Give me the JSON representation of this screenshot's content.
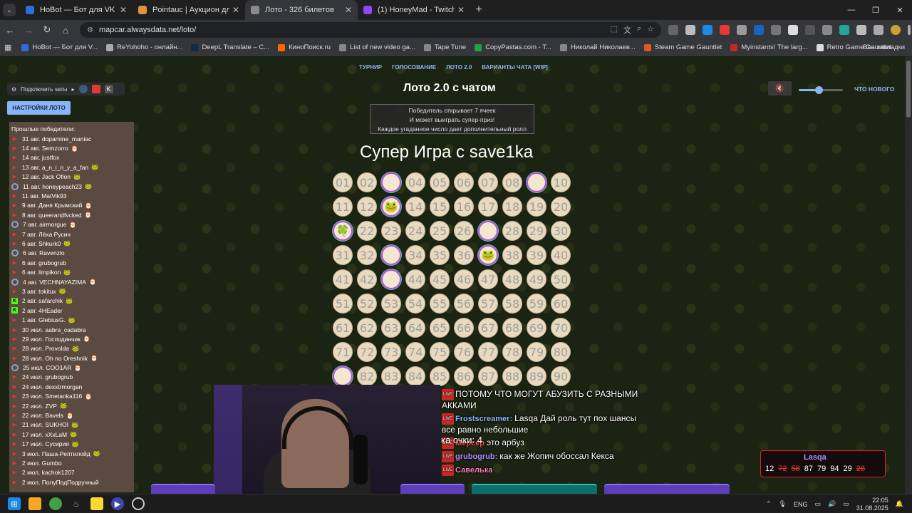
{
  "browser": {
    "tabs": [
      {
        "title": "HoBot — Бот для VK Video",
        "active": false,
        "color": "#2a6fdb"
      },
      {
        "title": "Pointauc | Аукцион для стримеров",
        "active": false,
        "color": "#e0913d"
      },
      {
        "title": "Лото - 326 билетов",
        "active": true,
        "color": "#8a8a8a"
      },
      {
        "title": "(1) HoneyMad - Twitch",
        "active": false,
        "color": "#9146ff"
      }
    ],
    "url": "mapcar.alwaysdata.net/loto/",
    "bookmarks": [
      {
        "label": "HoBot — Бот для V...",
        "color": "#2a6fdb"
      },
      {
        "label": "ReYohoho - онлайн...",
        "color": "#aaaaaa"
      },
      {
        "label": "DeepL Translate – C...",
        "color": "#0f2b46"
      },
      {
        "label": "КиноПоиск.ru",
        "color": "#ff6600"
      },
      {
        "label": "List of new video ga...",
        "color": "#888888"
      },
      {
        "label": "Tape Tune",
        "color": "#888888"
      },
      {
        "label": "CopyPastas.com - T...",
        "color": "#1fa34a"
      },
      {
        "label": "Николай Николаев...",
        "color": "#888888"
      },
      {
        "label": "Steam Game Gauntlet",
        "color": "#e25822"
      },
      {
        "label": "Myinstants! The larg...",
        "color": "#c62828"
      },
      {
        "label": "Retro Game Gauntlet",
        "color": "#dddddd"
      }
    ],
    "all_bookmarks": "Все закладки"
  },
  "page": {
    "nav": [
      "ТУРНИР",
      "ГОЛОСОВАНИЕ",
      "ЛОТО 2.0",
      "ВАРИАНТЫ ЧАТА [WIP]"
    ],
    "title": "Лото 2.0 с чатом",
    "info_lines": [
      "Победитель открывает 7 ячеек",
      "И может выиграть супер-приз!",
      "Каждое угаданное число дает дополнительный ролл"
    ],
    "subtitle": "Супер Игра с save1ka",
    "connect_chats": "Подключить чаты",
    "lotto_settings": "НАСТРОЙКИ ЛОТО",
    "whats_new": "ЧТО НОВОГО",
    "volume_level": 0.45,
    "winners_header": "Прошлые победители:",
    "winners": [
      {
        "text": "31 авг. dopamine_maniac",
        "src": "tw",
        "emote": ""
      },
      {
        "text": "14 авг. Semzorro",
        "src": "tw",
        "emote": "🎅"
      },
      {
        "text": "14 авг. justfox",
        "src": "tw",
        "emote": ""
      },
      {
        "text": "13 авг. a_n_i_n_y_a_fan",
        "src": "tw",
        "emote": "🐸"
      },
      {
        "text": "12 авг. Jack Ofion",
        "src": "tw",
        "emote": "🐸"
      },
      {
        "text": "11 авг. honeypeach23",
        "src": "gg",
        "emote": "🐸"
      },
      {
        "text": "11 авг. MatVik93",
        "src": "tw",
        "emote": ""
      },
      {
        "text": "9 авг. Даня Крымский",
        "src": "tw",
        "emote": "🎅"
      },
      {
        "text": "8 авг. queerandfvcked",
        "src": "tw",
        "emote": "🎅"
      },
      {
        "text": "7 авг. airmorgue",
        "src": "gg",
        "emote": "🎅"
      },
      {
        "text": "7 авг. Лёха Русич",
        "src": "tw",
        "emote": ""
      },
      {
        "text": "6 авг. Shkurk0",
        "src": "tw",
        "emote": "🐸"
      },
      {
        "text": "6 авг. Ravenzlo",
        "src": "gg",
        "emote": ""
      },
      {
        "text": "6 авг. grubogrub",
        "src": "tw",
        "emote": ""
      },
      {
        "text": "6 авг. limpikon",
        "src": "tw",
        "emote": "🐸"
      },
      {
        "text": "4 авг. VECHNAYAZIMA",
        "src": "gg",
        "emote": "🎅"
      },
      {
        "text": "3 авг. tokitux",
        "src": "tw",
        "emote": "🐸"
      },
      {
        "text": "2 авг. safarchik",
        "src": "kk",
        "emote": "🐸"
      },
      {
        "text": "2 авг. 4HEader",
        "src": "kk",
        "emote": ""
      },
      {
        "text": "1 авг. GlebiusG.",
        "src": "tw",
        "emote": "🐸"
      },
      {
        "text": "30 июл. aabra_cadabra",
        "src": "tw",
        "emote": ""
      },
      {
        "text": "29 июл. Господинчик",
        "src": "tw",
        "emote": "🎅"
      },
      {
        "text": "28 июл. Provolda",
        "src": "tw",
        "emote": "🐸"
      },
      {
        "text": "28 июл. Oh no Oreshnik",
        "src": "tw",
        "emote": "🎅"
      },
      {
        "text": "25 июл. COO1AR",
        "src": "gg",
        "emote": "🎅"
      },
      {
        "text": "24 июл. grubogrub",
        "src": "tw",
        "emote": ""
      },
      {
        "text": "24 июл. dexxtrmorgan",
        "src": "tw",
        "emote": ""
      },
      {
        "text": "23 июл. Smetanka116",
        "src": "tw",
        "emote": "🎅"
      },
      {
        "text": "22 июл. ZVP",
        "src": "tw",
        "emote": "🐸"
      },
      {
        "text": "22 июл. Bavels",
        "src": "tw",
        "emote": "🎅"
      },
      {
        "text": "21 июл. SUKHOI",
        "src": "tw",
        "emote": "🐸"
      },
      {
        "text": "17 июл. xXxLaM",
        "src": "tw",
        "emote": "🐸"
      },
      {
        "text": "17 июл. Сусирия",
        "src": "tw",
        "emote": "🐸"
      },
      {
        "text": "3 июл. Паша-Рептилойд",
        "src": "tw",
        "emote": "🐸"
      },
      {
        "text": "2 июл. Gumbo",
        "src": "tw",
        "emote": ""
      },
      {
        "text": "2 июл. kachok1207",
        "src": "tw",
        "emote": ""
      },
      {
        "text": "2 июл. ПолуПодПодручный",
        "src": "tw",
        "emote": ""
      }
    ],
    "marked_cells": {
      "03": "",
      "09": "",
      "13": "🐸",
      "21": "🍀",
      "27": "",
      "33": "",
      "37": "🐸",
      "43": "",
      "81": ""
    }
  },
  "chat": {
    "messages": [
      {
        "nick": "",
        "text": "ПОТОМУ ЧТО МОГУТ АБУЗИТЬ С РАЗНЫМИ АККАМИ",
        "nick_class": ""
      },
      {
        "nick": "Frostscreamer:",
        "text": "Lasqa Дай роль тут пох шансы все равно небольшие",
        "nick_class": "nick-blue"
      },
      {
        "nick": "Мерсер",
        "text": "это арбуз",
        "nick_class": "nick-red"
      },
      {
        "nick": "grubogrub:",
        "text": "как же Жопич обоссал Кекса",
        "nick_class": "nick-purple"
      }
    ],
    "points_text": "ка очки: 4",
    "last_nick": "Савелька"
  },
  "ticket": {
    "user": "Lasqa",
    "numbers": [
      "12",
      "72",
      "58",
      "87",
      "79",
      "94",
      "29",
      "28"
    ],
    "crossed": [
      "72",
      "58",
      "28"
    ]
  },
  "taskbar": {
    "lang": "ENG",
    "time": "22:05",
    "date": "31.08.2025"
  }
}
